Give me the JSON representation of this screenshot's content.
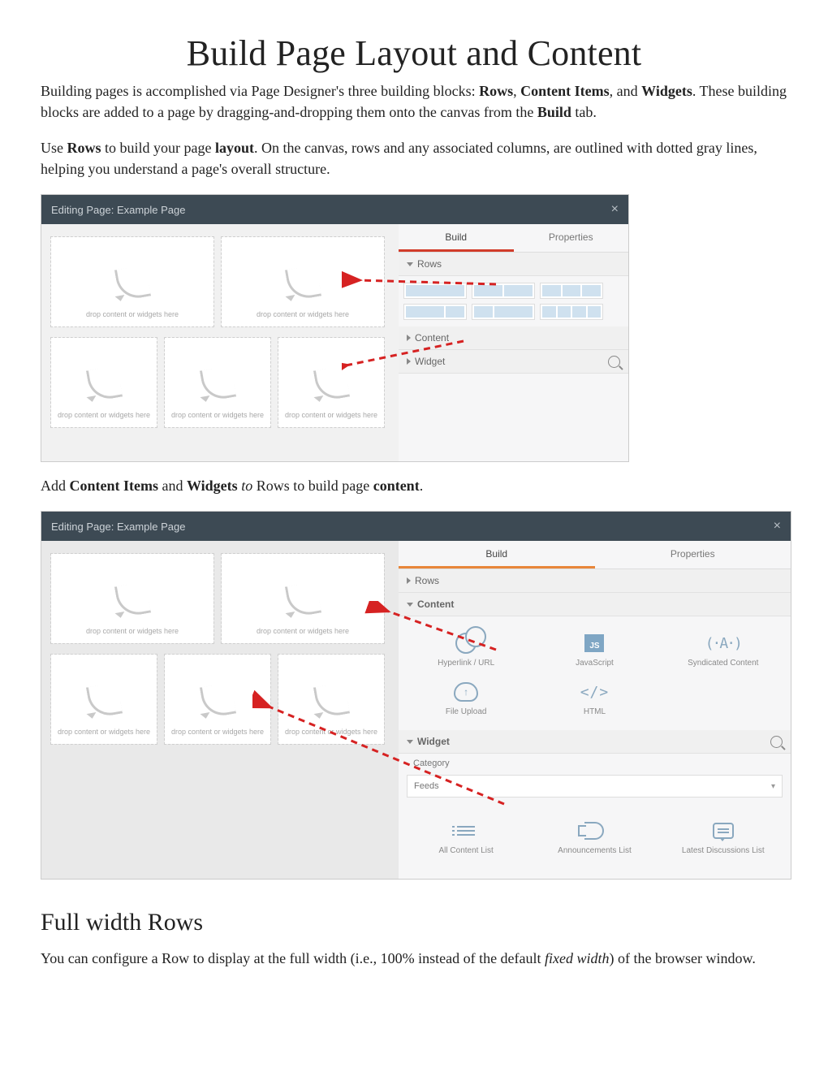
{
  "title": "Build Page Layout and Content",
  "para1_pre": "Building pages is accomplished via Page Designer's three building blocks: ",
  "b_rows": "Rows",
  "sep": ", ",
  "b_ci": "Content Items",
  "and": ", and ",
  "b_widgets": "Widgets",
  "para1_post": ". These building blocks are added to a page by dragging-and-dropping them onto the canvas from the ",
  "b_build": "Build",
  "para1_end": " tab.",
  "para2_a": "Use ",
  "para2_b": " to build your page ",
  "b_layout": "layout",
  "para2_c": ". On the canvas, rows and any associated columns, are outlined with dotted gray lines, helping you understand a page's overall structure.",
  "shot": {
    "titlebar": "Editing Page: Example Page",
    "close": "×",
    "tabs": {
      "build": "Build",
      "properties": "Properties"
    },
    "sections": {
      "rows": "Rows",
      "content": "Content",
      "widget": "Widget"
    },
    "drop_label": "drop content or widgets here",
    "content_items": [
      {
        "name": "Hyperlink / URL"
      },
      {
        "name": "JavaScript"
      },
      {
        "name": "Syndicated Content"
      },
      {
        "name": "File Upload"
      },
      {
        "name": "HTML"
      }
    ],
    "widget": {
      "category_label": "Category",
      "category_value": "Feeds",
      "items": [
        {
          "name": "All Content List"
        },
        {
          "name": "Announcements List"
        },
        {
          "name": "Latest Discussions List"
        }
      ]
    }
  },
  "para3_a": "Add ",
  "para3_b": " and ",
  "i_to": "to",
  "para3_c": " Rows to build page ",
  "b_content": "content",
  "para3_d": ".",
  "h2": "Full width Rows",
  "para4_a": "You can configure a Row to display at the full width (i.e., 100% instead of the default ",
  "i_fixed": "fixed width",
  "para4_b": ") of the browser window."
}
